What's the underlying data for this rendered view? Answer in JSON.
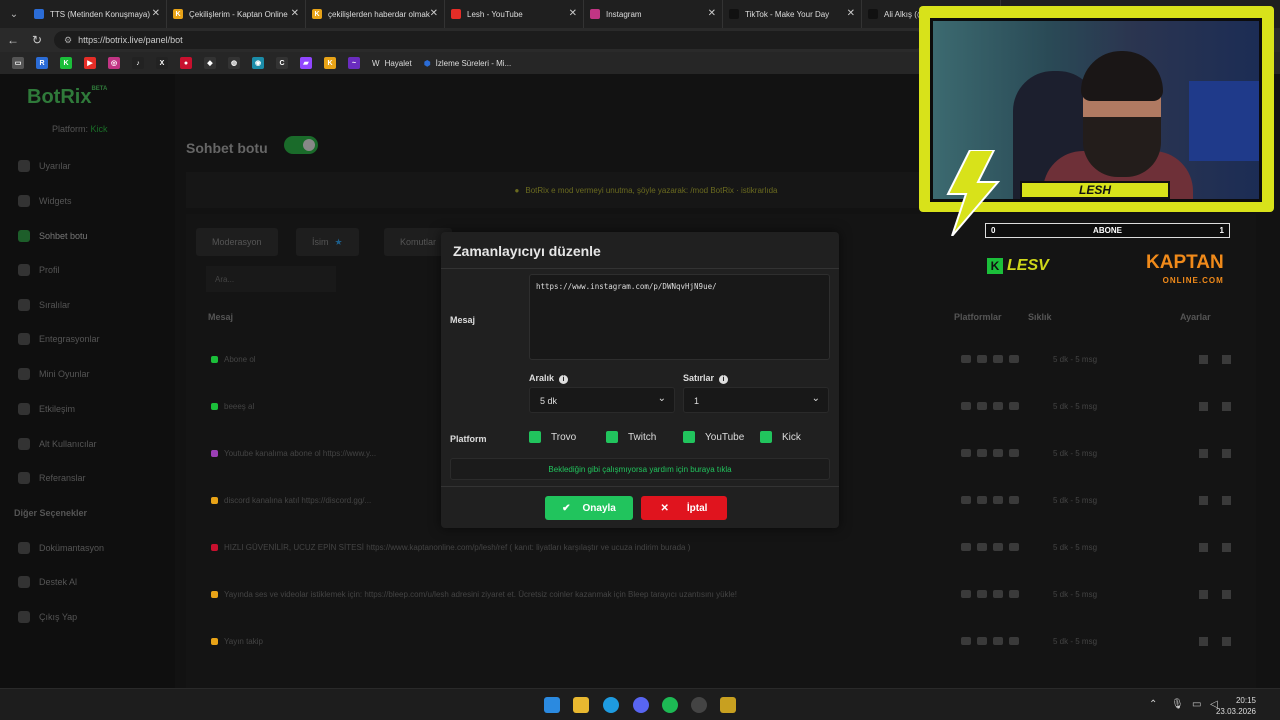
{
  "browser": {
    "tabs": [
      {
        "title": "TTS (Metinden Konuşmaya)",
        "color": "#2b6cd6"
      },
      {
        "title": "Çekilişlerim - Kaptan Online",
        "color": "#e8a317",
        "glyph": "K"
      },
      {
        "title": "çekilişlerden haberdar olmak",
        "color": "#e8a317",
        "glyph": "K"
      },
      {
        "title": "Lesh - YouTube",
        "color": "#e52d27"
      },
      {
        "title": "Instagram",
        "color": "#c13584"
      },
      {
        "title": "TikTok - Make Your Day",
        "color": "#111111"
      },
      {
        "title": "Ali Alkış (@",
        "color": "#111111"
      }
    ],
    "url": "https://botrix.live/panel/bot",
    "bookmarks": [
      "Hayalet",
      "İzleme Süreleri - Mi..."
    ]
  },
  "sidebar": {
    "logo": "BotRix",
    "logo_badge": "BETA",
    "platform_label": "Platform:",
    "platform_value": "Kick",
    "items": [
      "Uyarılar",
      "Widgets",
      "Sohbet botu",
      "Profil",
      "Sıralılar",
      "Entegrasyonlar",
      "Mini Oyunlar",
      "Etkileşim",
      "Alt Kullanıcılar",
      "Referanslar"
    ],
    "section": "Diğer Seçenekler",
    "other_items": [
      "Dokümantasyon",
      "Destek Al",
      "Çıkış Yap"
    ]
  },
  "main": {
    "title": "Sohbet botu",
    "banner": "BotRix e mod vermeyi unutma, şöyle yazarak: /mod BotRix  · istikrarlıda",
    "tabs": [
      "Moderasyon",
      "İsim",
      "Komutlar"
    ],
    "search_placeholder": "Ara...",
    "columns": {
      "message": "Mesaj",
      "platforms": "Platformlar",
      "frequency": "Sıklık",
      "settings": "Ayarlar"
    },
    "rows": [
      {
        "text": "Abone ol",
        "freq": "5 dk - 5 msg"
      },
      {
        "text": "beeeş al",
        "freq": "5 dk - 5 msg"
      },
      {
        "text": "Youtube kanalıma abone ol  https://www.y...",
        "freq": "5 dk - 5 msg"
      },
      {
        "text": "discord kanalına katıl  https://discord.gg/...",
        "freq": "5 dk - 5 msg"
      },
      {
        "text": "HIZLI GÜVENİLİR, UCUZ EPİN SİTESİ  https://www.kaptanonline.com/p/lesh/ref  ( kanıt: liyatları karşılaştır ve ucuza indirim burada )",
        "freq": "5 dk - 5 msg"
      },
      {
        "text": "Yayında ses ve videolar istiklemek için: https://bleep.com/u/lesh  adresini ziyaret et. Ücretsiz coinler kazanmak için Bleep tarayıcı uzantısını yükle!",
        "freq": "5 dk - 5 msg"
      },
      {
        "text": "Yayın takip",
        "freq": "5 dk - 5 msg"
      }
    ]
  },
  "modal": {
    "title": "Zamanlayıcıyı düzenle",
    "message_label": "Mesaj",
    "message_value": "https://www.instagram.com/p/DWNqvHjN9ue/",
    "interval_label": "Aralık",
    "interval_value": "5 dk",
    "lines_label": "Satırlar",
    "lines_value": "1",
    "platform_label": "Platform",
    "platforms": [
      "Trovo",
      "Twitch",
      "YouTube",
      "Kick"
    ],
    "help_text": "Beklediğin gibi çalışmıyorsa yardım için buraya tıkla",
    "confirm": "Onayla",
    "cancel": "İptal",
    "accent": "#21c45d",
    "danger": "#e0141e"
  },
  "stream_overlay": {
    "name": "LESH",
    "subscribers_label": "ABONE",
    "subscribers_left": "0",
    "subscribers_right": "1",
    "sponsor": "KAPTAN",
    "sponsor_sub": "ONLINE.COM",
    "brand": "LESV"
  },
  "taskbar": {
    "time": "20:15",
    "date": "23.03.2026"
  }
}
